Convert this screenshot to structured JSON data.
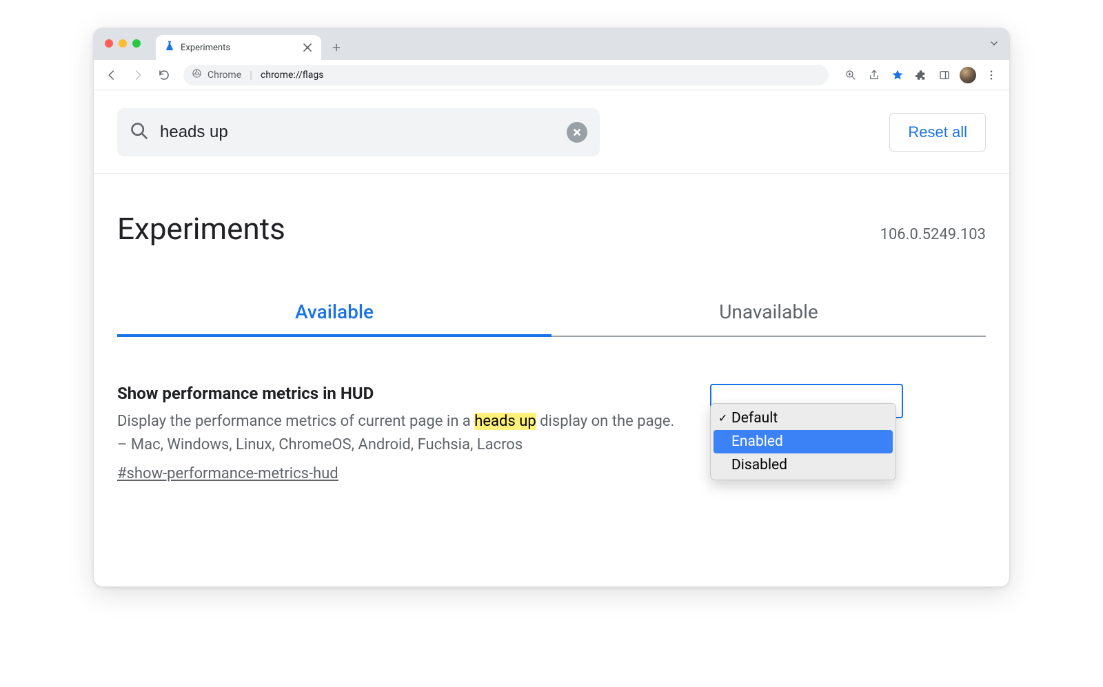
{
  "browser": {
    "tab_title": "Experiments",
    "address_origin": "Chrome",
    "address_path": "chrome://flags"
  },
  "search": {
    "value": "heads up",
    "reset_label": "Reset all"
  },
  "header": {
    "title": "Experiments",
    "version": "106.0.5249.103"
  },
  "tabs": {
    "available": "Available",
    "unavailable": "Unavailable"
  },
  "flag": {
    "title": "Show performance metrics in HUD",
    "desc_before": "Display the performance metrics of current page in a ",
    "desc_highlight": "heads up",
    "desc_after": " display on the page. – Mac, Windows, Linux, ChromeOS, Android, Fuchsia, Lacros",
    "anchor": "#show-performance-metrics-hud"
  },
  "dropdown": {
    "options": [
      "Default",
      "Enabled",
      "Disabled"
    ],
    "checked": "Default",
    "hovered": "Enabled"
  }
}
